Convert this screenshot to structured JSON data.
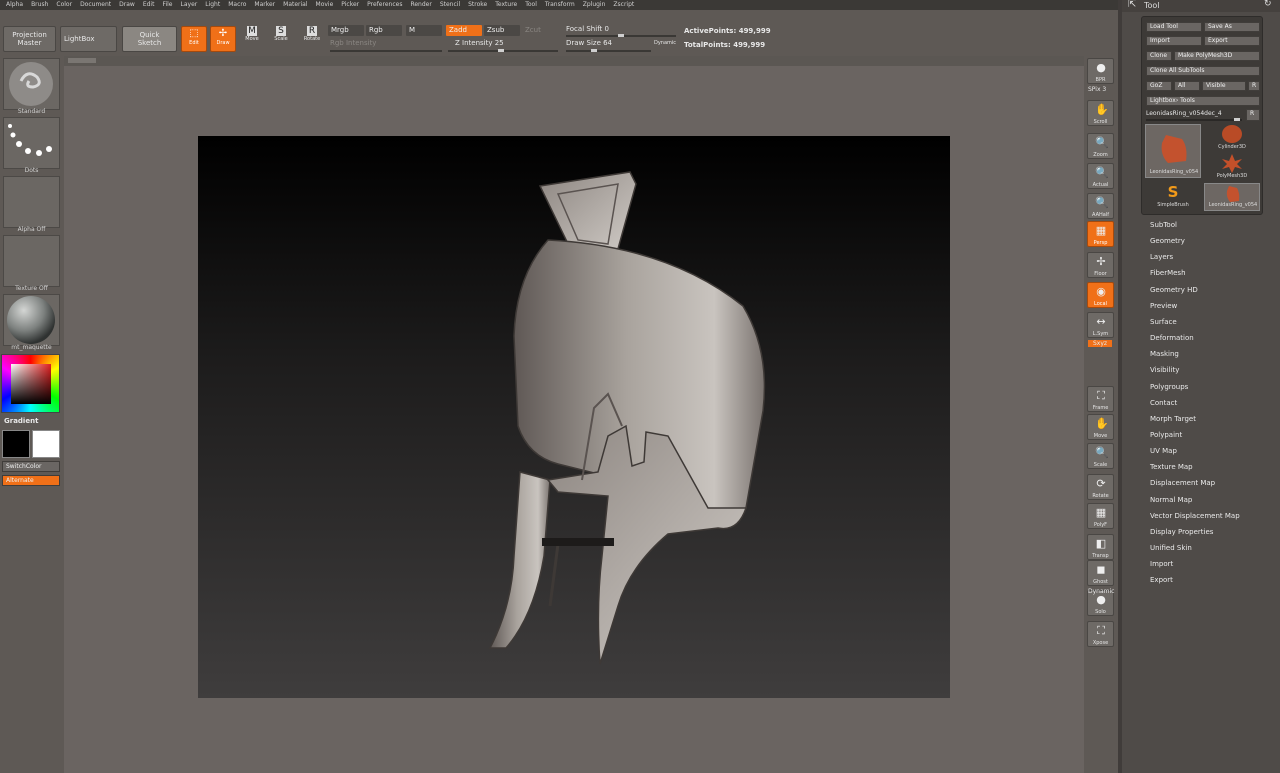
{
  "menu": [
    "Alpha",
    "Brush",
    "Color",
    "Document",
    "Draw",
    "Edit",
    "File",
    "Layer",
    "Light",
    "Macro",
    "Marker",
    "Material",
    "Movie",
    "Picker",
    "Preferences",
    "Render",
    "Stencil",
    "Stroke",
    "Texture",
    "Tool",
    "Transform",
    "Zplugin",
    "Zscript"
  ],
  "toolbar": {
    "projection_master": "Projection\nMaster",
    "lightbox": "LightBox",
    "quick_sketch": "Quick\nSketch",
    "edit": "Edit",
    "draw": "Draw",
    "move": "Move",
    "scale": "Scale",
    "rotate": "Rotate",
    "mrgb": "Mrgb",
    "rgb": "Rgb",
    "m": "M",
    "rgb_intensity": "Rgb  Intensity",
    "zadd": "Zadd",
    "zsub": "Zsub",
    "zcut": "Zcut",
    "z_intensity": "Z Intensity 25",
    "focal_shift": "Focal Shift 0",
    "draw_size": "Draw Size 64",
    "dynamic": "Dynamic",
    "active_points": "ActivePoints: 499,999",
    "total_points": "TotalPoints: 499,999"
  },
  "left_shelf": {
    "brush": "Standard",
    "stroke": "Dots",
    "alpha": "Alpha  Off",
    "texture": "Texture  Off",
    "material": "mt_maquette",
    "gradient": "Gradient",
    "switch_color": "SwitchColor",
    "alternate": "Alternate"
  },
  "right_shelf": [
    {
      "label": "BPR",
      "icon": "bpr-icon",
      "glyph": "●",
      "on": false
    },
    {
      "label": "Scroll",
      "icon": "scroll-icon",
      "glyph": "✋",
      "on": false
    },
    {
      "label": "Zoom",
      "icon": "zoom-icon",
      "glyph": "🔍",
      "on": false
    },
    {
      "label": "Actual",
      "icon": "actual-icon",
      "glyph": "🔍",
      "on": false
    },
    {
      "label": "AAHalf",
      "icon": "aahalf-icon",
      "glyph": "🔍",
      "on": false
    },
    {
      "label": "Persp",
      "icon": "persp-icon",
      "glyph": "▦",
      "on": true
    },
    {
      "label": "Floor",
      "icon": "floor-icon",
      "glyph": "✢",
      "on": false
    },
    {
      "label": "Local",
      "icon": "local-icon",
      "glyph": "◉",
      "on": true
    },
    {
      "label": "L.Sym",
      "icon": "lsym-icon",
      "glyph": "↔",
      "on": false
    },
    {
      "label": "Frame",
      "icon": "frame-icon",
      "glyph": "⛶",
      "on": false
    },
    {
      "label": "Move",
      "icon": "move-icon",
      "glyph": "✋",
      "on": false
    },
    {
      "label": "Scale",
      "icon": "scale-icon",
      "glyph": "🔍",
      "on": false
    },
    {
      "label": "Rotate",
      "icon": "rotate-icon",
      "glyph": "⟳",
      "on": false
    },
    {
      "label": "PolyF",
      "icon": "polyf-icon",
      "glyph": "▦",
      "on": false
    },
    {
      "label": "Transp",
      "icon": "transp-icon",
      "glyph": "◧",
      "on": false
    },
    {
      "label": "Ghost",
      "icon": "ghost-icon",
      "glyph": "◼",
      "on": false
    },
    {
      "label": "Solo",
      "icon": "solo-icon",
      "glyph": "●",
      "on": false
    },
    {
      "label": "Xpose",
      "icon": "xpose-icon",
      "glyph": "⛶",
      "on": false
    }
  ],
  "spix": "SPix 3",
  "xyz": "Sxyz",
  "dynamic_label": "Dynamic",
  "tool": {
    "title": "Tool",
    "load_tool": "Load Tool",
    "save_as": "Save As",
    "import": "Import",
    "export": "Export",
    "clone": "Clone",
    "make_polymesh": "Make PolyMesh3D",
    "clone_all": "Clone All SubTools",
    "goz": "GoZ",
    "all": "All",
    "visible": "Visible",
    "r": "R",
    "lightbox_tools": "Lightbox› Tools",
    "current_tool": "LeonidasRing_v054dec_4",
    "thumbs": [
      "LeonidasRing_v054",
      "Cylinder3D",
      "PolyMesh3D",
      "SimpleBrush",
      "LeonidasRing_v054"
    ],
    "subpalettes": [
      "SubTool",
      "Geometry",
      "Layers",
      "FiberMesh",
      "Geometry HD",
      "Preview",
      "Surface",
      "Deformation",
      "Masking",
      "Visibility",
      "Polygroups",
      "Contact",
      "Morph Target",
      "Polypaint",
      "UV Map",
      "Texture Map",
      "Displacement Map",
      "Normal Map",
      "Vector Displacement Map",
      "Display Properties",
      "Unified Skin",
      "Import",
      "Export"
    ]
  },
  "colors": {
    "accent": "#f07018",
    "bg": "#66605c",
    "panel": "#5e5955"
  }
}
